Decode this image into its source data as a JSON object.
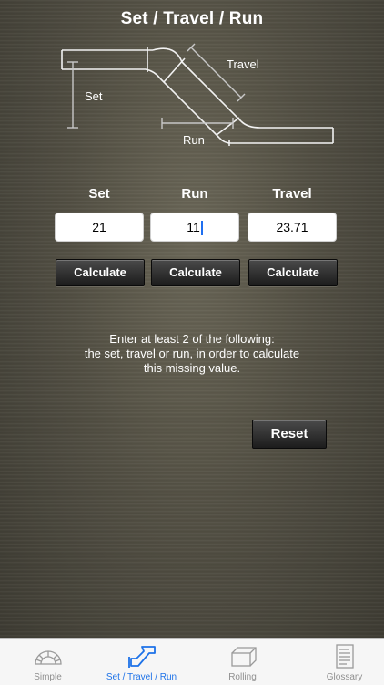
{
  "header": {
    "title": "Set / Travel / Run"
  },
  "diagram": {
    "travel_label": "Travel",
    "set_label": "Set",
    "run_label": "Run"
  },
  "columns": [
    {
      "label": "Set",
      "value": "21",
      "button": "Calculate"
    },
    {
      "label": "Run",
      "value": "11",
      "button": "Calculate"
    },
    {
      "label": "Travel",
      "value": "23.71",
      "button": "Calculate"
    }
  ],
  "hint": {
    "line1": "Enter at least 2 of the following:",
    "line2": "the set, travel or run, in order to calculate",
    "line3": "this missing value."
  },
  "reset_label": "Reset",
  "tabs": [
    {
      "label": "Simple",
      "icon": "protractor-icon",
      "active": false
    },
    {
      "label": "Set / Travel / Run",
      "icon": "pipe-offset-icon",
      "active": true
    },
    {
      "label": "Rolling",
      "icon": "box-icon",
      "active": false
    },
    {
      "label": "Glossary",
      "icon": "document-icon",
      "active": false
    }
  ],
  "colors": {
    "accent": "#1d72e8",
    "tab_inactive": "#8f8f8f"
  }
}
